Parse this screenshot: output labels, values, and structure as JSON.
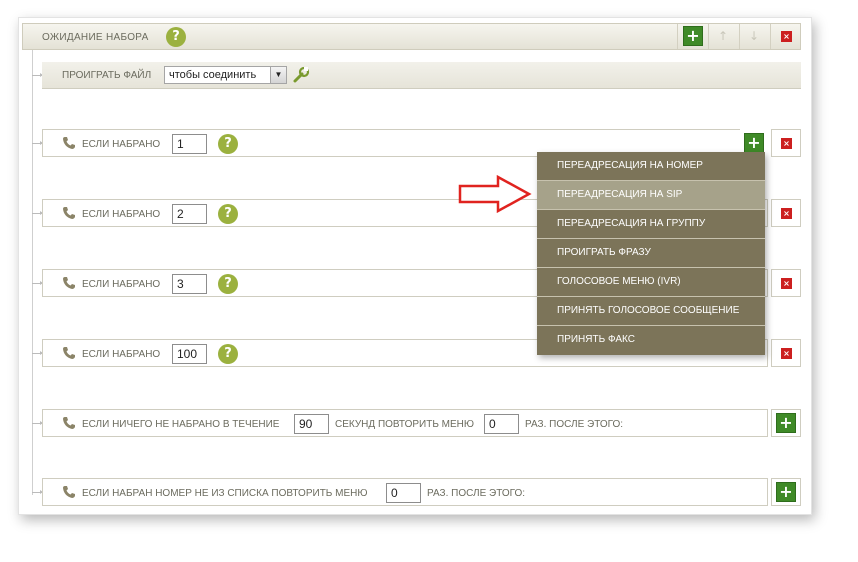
{
  "header": {
    "title": "ОЖИДАНИЕ НАБОРА",
    "help": "?"
  },
  "play_file": {
    "label": "ПРОИГРАТЬ ФАЙЛ",
    "value": "чтобы соединить"
  },
  "rows": [
    {
      "label": "ЕСЛИ НАБРАНО",
      "value": "1"
    },
    {
      "label": "ЕСЛИ НАБРАНО",
      "value": "2"
    },
    {
      "label": "ЕСЛИ НАБРАНО",
      "value": "3"
    },
    {
      "label": "ЕСЛИ НАБРАНО",
      "value": "100"
    }
  ],
  "timeout_row": {
    "label1": "ЕСЛИ НИЧЕГО НЕ НАБРАНО В ТЕЧЕНИЕ",
    "seconds": "90",
    "label2": "СЕКУНД ПОВТОРИТЬ МЕНЮ",
    "times": "0",
    "label3": "РАЗ. ПОСЛЕ ЭТОГО:"
  },
  "invalid_row": {
    "label1": "ЕСЛИ НАБРАН НОМЕР НЕ ИЗ СПИСКА ПОВТОРИТЬ МЕНЮ",
    "times": "0",
    "label2": "РАЗ. ПОСЛЕ ЭТОГО:"
  },
  "menu": {
    "items": [
      "ПЕРЕАДРЕСАЦИЯ НА НОМЕР",
      "ПЕРЕАДРЕСАЦИЯ НА SIP",
      "ПЕРЕАДРЕСАЦИЯ НА ГРУППУ",
      "ПРОИГРАТЬ ФРАЗУ",
      "ГОЛОСОВОЕ МЕНЮ (IVR)",
      "ПРИНЯТЬ ГОЛОСОВОЕ СООБЩЕНИЕ",
      "ПРИНЯТЬ ФАКС"
    ],
    "selected_index": 1
  },
  "icons": {
    "plus": "+",
    "up": "↑",
    "down": "↓",
    "delete": "×",
    "select_arrow": "▼"
  },
  "colors": {
    "accent_green": "#3f8a27",
    "menu_bg": "#7c7459",
    "menu_selected": "#a6a28a",
    "delete_red": "#cc1f1f",
    "help_green": "#9bb13f"
  }
}
